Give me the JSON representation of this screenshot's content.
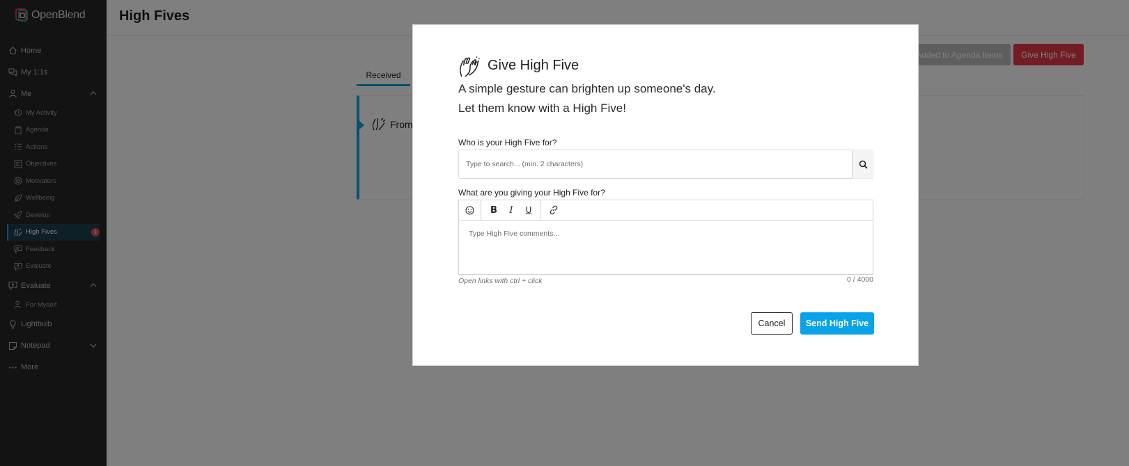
{
  "app": {
    "logo_text": "OpenBlend"
  },
  "sidebar": {
    "home": "Home",
    "my11s": "My 1:1s",
    "me": "Me",
    "me_items": {
      "my_activity": "My Activity",
      "agenda": "Agenda",
      "actions": "Actions",
      "objectives": "Objectives",
      "motivators": "Motivators",
      "wellbeing": "Wellbeing",
      "develop": "Develop",
      "high_fives": "High Fives",
      "high_fives_badge": "1",
      "feedback": "Feedback",
      "evaluate": "Evaluate"
    },
    "evaluate": "Evaluate",
    "evaluate_items": {
      "for_myself": "For Myself"
    },
    "lightbulb": "Lightbulb",
    "notepad": "Notepad",
    "more": "More"
  },
  "page": {
    "title": "High Fives",
    "btn_agenda": "Added to Agenda Items",
    "btn_give": "Give High Five",
    "tab_received": "Received",
    "card_from": "From"
  },
  "modal": {
    "title": "Give High Five",
    "subtitle_line1": "A simple gesture can brighten up someone's day.",
    "subtitle_line2": "Let them know with a High Five!",
    "who_label": "Who is your High Five for?",
    "search_placeholder": "Type to search... (min. 2 characters)",
    "what_label": "What are you giving your High Five for?",
    "toolbar": {
      "bold": "B",
      "italic": "I",
      "underline": "U"
    },
    "comment_placeholder": "Type High Five comments...",
    "hint": "Open links with ctrl + click",
    "counter": "0 / 4000",
    "cancel": "Cancel",
    "send": "Send High Five"
  },
  "colors": {
    "accent": "#0aa3e8",
    "danger": "#e63946",
    "sidebar_bg": "#262626"
  }
}
